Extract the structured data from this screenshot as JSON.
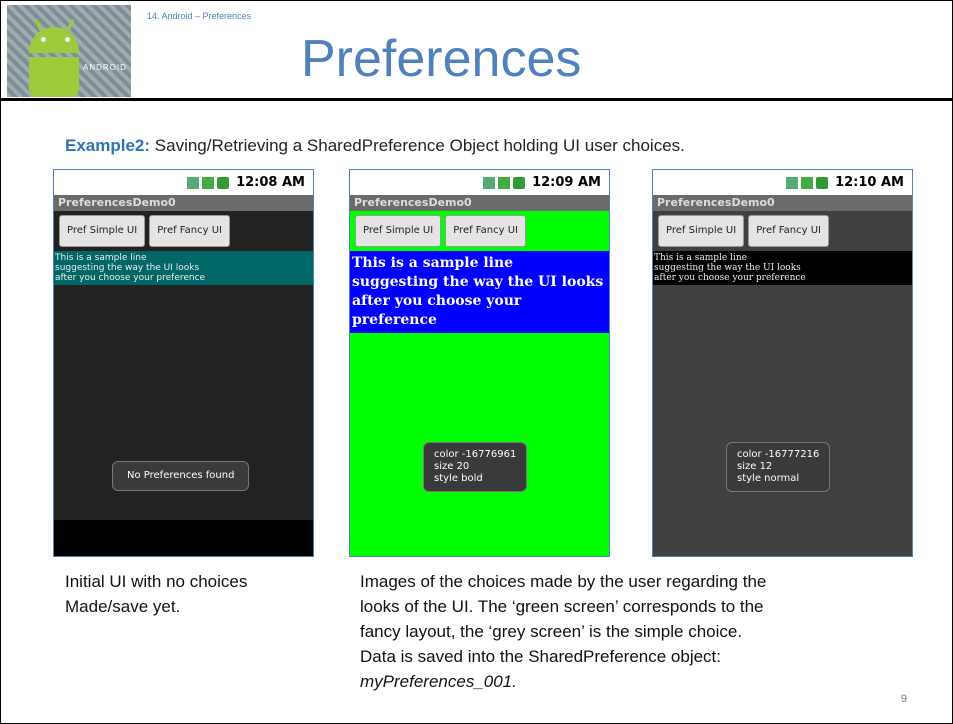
{
  "slide": {
    "tag": "14. Android – Preferences",
    "title": "Preferences",
    "example_label": "Example2:",
    "example_text": " Saving/Retrieving a SharedPreference Object holding UI user choices.",
    "logo_text": "ANDROID",
    "page_number": "9"
  },
  "phones": [
    {
      "time": "12:08 AM",
      "app_title": "PreferencesDemo0",
      "btn_simple": "Pref Simple UI",
      "btn_fancy": "Pref Fancy UI",
      "sample": "This is a sample line\nsuggesting the way the UI looks\nafter you choose your preference",
      "toast": "No Preferences found"
    },
    {
      "time": "12:09 AM",
      "app_title": "PreferencesDemo0",
      "btn_simple": "Pref Simple UI",
      "btn_fancy": "Pref Fancy UI",
      "sample": "This is a sample line\nsuggesting the way the UI looks\nafter you choose your\npreference",
      "toast_l1": "color -16776961",
      "toast_l2": "size 20",
      "toast_l3": "style bold"
    },
    {
      "time": "12:10 AM",
      "app_title": "PreferencesDemo0",
      "btn_simple": "Pref Simple UI",
      "btn_fancy": "Pref Fancy UI",
      "sample": "This is a sample line\nsuggesting the way the UI looks\nafter you choose your preference",
      "toast_l1": "color -16777216",
      "toast_l2": "size 12",
      "toast_l3": "style normal"
    }
  ],
  "captions": {
    "left_1": "Initial UI with no choices",
    "left_2": "Made/save yet.",
    "right_1": "Images of the choices made by the user regarding the",
    "right_2": "looks of the UI. The ‘green screen’ corresponds to the",
    "right_3": "fancy layout, the ‘grey screen’ is the simple choice.",
    "right_4": "Data is saved into the SharedPreference object:",
    "right_5": "myPreferences_001."
  },
  "colors": {
    "title_blue": "#4f81bd",
    "fancy_bg": "#00ff00",
    "fancy_text_bg": "#0000ff",
    "simple_bg": "#404040",
    "initial_text_bg": "#006666"
  }
}
